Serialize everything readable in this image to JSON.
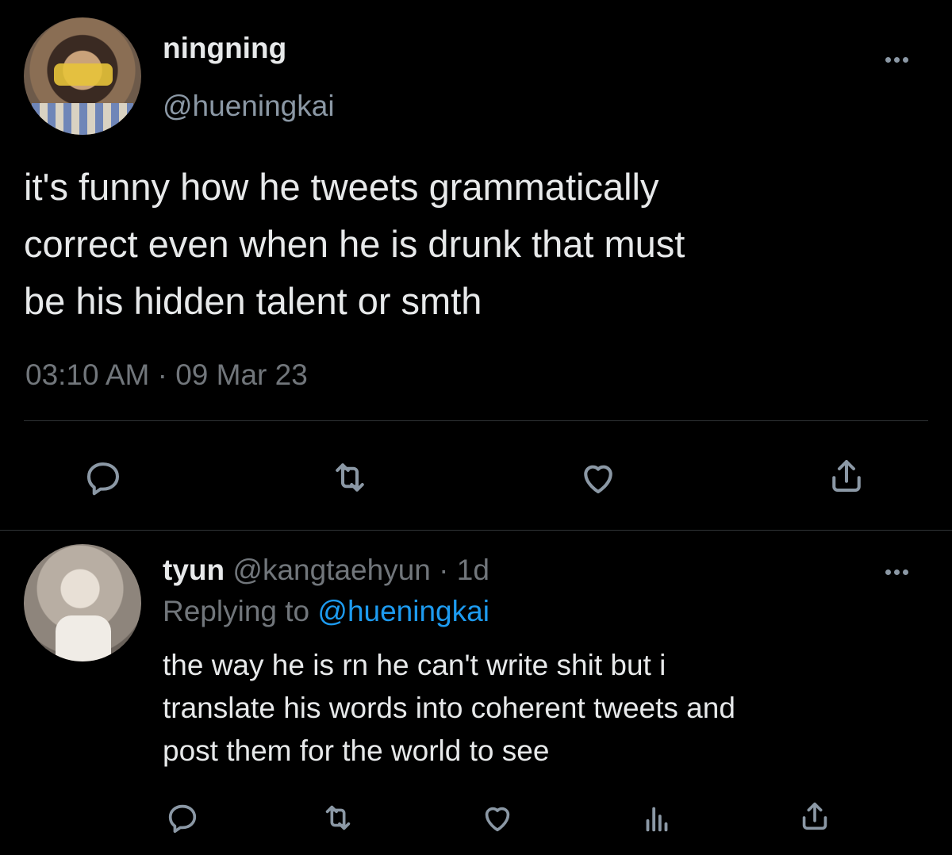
{
  "main_tweet": {
    "display_name": "ningning",
    "handle": "@hueningkai",
    "text_lines": [
      "it's funny how he tweets grammatically",
      "correct even when he is drunk that must",
      "be his hidden talent or smth"
    ],
    "timestamp": "03:10 AM · 09 Mar 23",
    "avatar_icon": "profile-photo-icon",
    "actions": [
      "reply-icon",
      "retweet-icon",
      "like-icon",
      "share-icon"
    ]
  },
  "reply": {
    "display_name": "tyun",
    "handle": "@kangtaehyun",
    "time": "· 1d",
    "replying_prefix": "Replying to",
    "replying_handle": "@hueningkai",
    "text_lines": [
      "the way he is rn he can't write shit but i",
      "translate his words into coherent tweets and",
      "post them for the world to see"
    ],
    "actions": [
      "reply-icon",
      "retweet-icon",
      "like-icon",
      "analytics-icon",
      "share-icon"
    ]
  },
  "colors": {
    "background": "#000000",
    "text": "#e7e9ea",
    "muted": "#71767b",
    "link": "#1d9bf0",
    "divider": "#2f3336"
  }
}
